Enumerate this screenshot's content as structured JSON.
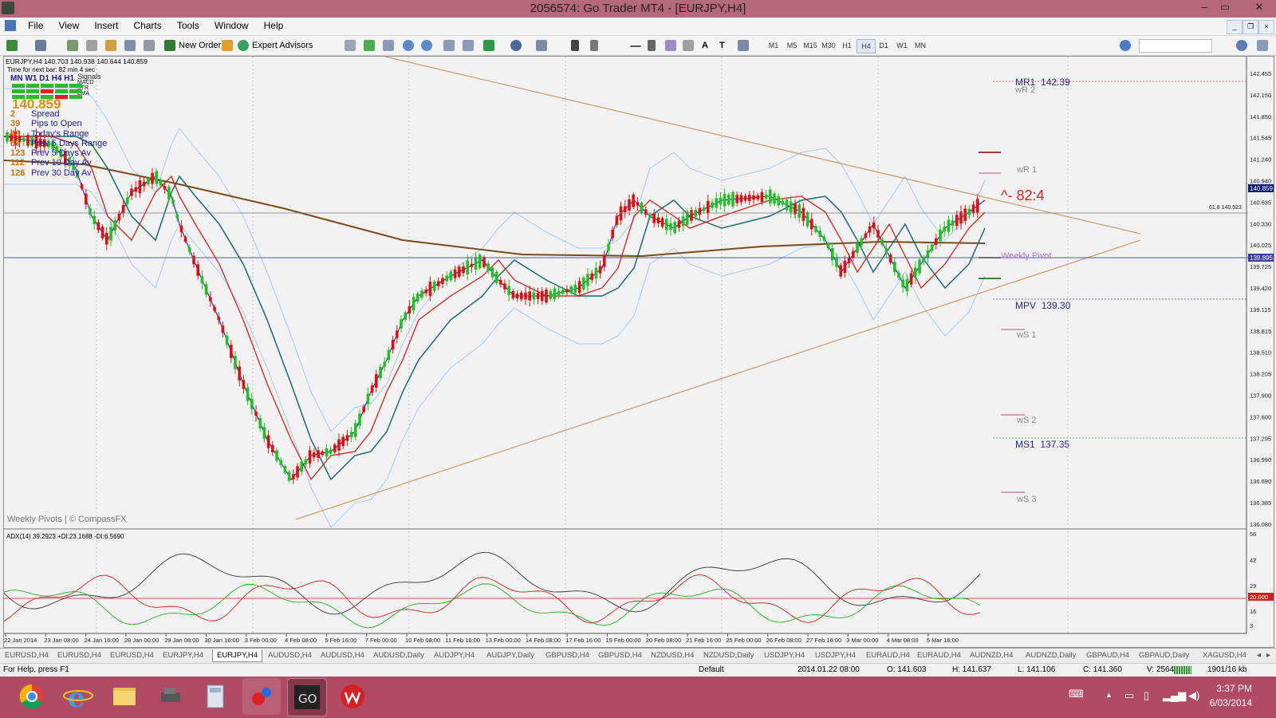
{
  "window": {
    "title": "2056574: Go Trader MT4 - [EURJPY,H4]",
    "controls": [
      "–",
      "▭",
      "✕"
    ]
  },
  "menu": [
    "File",
    "View",
    "Insert",
    "Charts",
    "Tools",
    "Window",
    "Help"
  ],
  "toolbar": {
    "new_order": "New Order",
    "expert_advisors": "Expert Advisors",
    "timeframes": [
      "M1",
      "M5",
      "M15",
      "M30",
      "H1",
      "H4",
      "D1",
      "W1",
      "MN"
    ],
    "active_timeframe": "H4"
  },
  "chart": {
    "header": "EURJPY,H4  140.703 140.938 140.644 140.859",
    "next_bar": "Time for next bar: 82 min 4 sec",
    "signals": {
      "title": "MN W1 D1  H4  H1",
      "labels": [
        "Signals",
        "MACD",
        "STR",
        "EMA"
      ],
      "price": "140.859"
    },
    "stats": [
      {
        "value": "2",
        "label": "Spread"
      },
      {
        "value": "39",
        "label": "Pips to Open"
      },
      {
        "value": "48",
        "label": "Today's Range"
      },
      {
        "value": "69",
        "label": "Prev 5 Days Range"
      },
      {
        "value": "123",
        "label": "Prev 5 Days Av"
      },
      {
        "value": "112",
        "label": "Prev 10 Day Av"
      },
      {
        "value": "126",
        "label": "Prev 30 Day Av"
      }
    ],
    "watermark": "Weekly Pivots | © CompassFX",
    "countdown": "^- 82:4",
    "fib_label": "61.8  140.523",
    "pivots": [
      {
        "name": "MR1",
        "value": "142.39"
      },
      {
        "name": "wR 2",
        "value": ""
      },
      {
        "name": "wR 1",
        "value": ""
      },
      {
        "name": "Weekly Pivot",
        "value": ""
      },
      {
        "name": "MPV",
        "value": "139.30"
      },
      {
        "name": "wS 1",
        "value": ""
      },
      {
        "name": "wS 2",
        "value": ""
      },
      {
        "name": "MS1",
        "value": "137.35"
      },
      {
        "name": "wS 3",
        "value": ""
      }
    ],
    "price_axis": [
      "142.455",
      "142.150",
      "141.850",
      "141.545",
      "141.240",
      "140.940",
      "140.635",
      "140.330",
      "140.025",
      "139.725",
      "139.420",
      "139.115",
      "138.815",
      "138.510",
      "138.205",
      "137.900",
      "137.600",
      "137.295",
      "136.990",
      "136.690",
      "136.385",
      "136.080"
    ],
    "price_tags": {
      "current": "140.859",
      "pivot": "139.895"
    },
    "adx_header": "ADX(14) 39.2923 +DI:23.1688 -DI:6.5690",
    "adx_axis": [
      "56",
      "42",
      "29",
      "20.000",
      "16",
      "3"
    ],
    "time_axis": [
      "22 Jan 2014",
      "23 Jan 08:00",
      "24 Jan 16:00",
      "28 Jan 00:00",
      "29 Jan 08:00",
      "30 Jan 16:00",
      "3 Feb 00:00",
      "4 Feb 08:00",
      "5 Feb 16:00",
      "7 Feb 00:00",
      "10 Feb 08:00",
      "11 Feb 16:00",
      "13 Feb 00:00",
      "14 Feb 08:00",
      "17 Feb 16:00",
      "19 Feb 00:00",
      "20 Feb 08:00",
      "21 Feb 16:00",
      "25 Feb 00:00",
      "26 Feb 08:00",
      "27 Feb 16:00",
      "3 Mar 00:00",
      "4 Mar 08:00",
      "5 Mar 16:00"
    ]
  },
  "tabs": [
    "EURUSD,H4",
    "EURUSD,H4",
    "EURUSD,H4",
    "EURJPY,H4",
    "EURJPY,H4",
    "AUDUSD,H4",
    "AUDUSD,H4",
    "AUDUSD,Daily",
    "AUDJPY,H4",
    "AUDJPY,Daily",
    "GBPUSD,H4",
    "GBPUSD,H4",
    "NZDUSD,H4",
    "NZDUSD,Daily",
    "USDJPY,H4",
    "USDJPY,H4",
    "EURAUD,H4",
    "EURAUD,H4",
    "AUDNZD,H4",
    "AUDNZD,Daily",
    "GBPAUD,H4",
    "GBPAUD,Daily",
    "XAGUSD,H4"
  ],
  "active_tab_index": 4,
  "status": {
    "help": "For Help, press F1",
    "profile": "Default",
    "datetime": "2014.01.22 08:00",
    "open": "O: 141.603",
    "high": "H: 141.637",
    "low": "L: 141.106",
    "close": "C: 141.360",
    "volume": "V: 25643",
    "traffic": "1901/16 kb"
  },
  "taskbar": {
    "time": "3:37 PM",
    "date": "6/03/2014"
  },
  "colors": {
    "titlebar": "#b5687a",
    "taskbar": "#b14a63",
    "bull_candle": "#22c022",
    "bear_candle": "#e01010",
    "pivot_purple": "#9a5fbf",
    "trendline": "#c8a070"
  }
}
